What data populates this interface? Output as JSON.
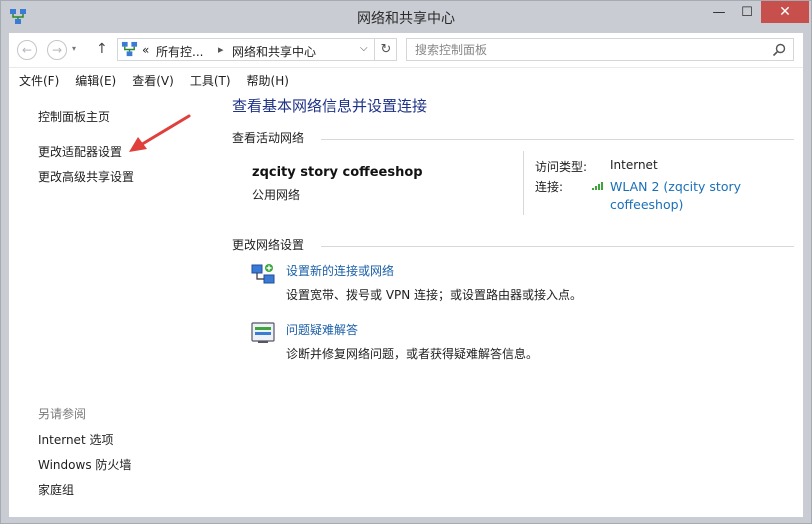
{
  "window": {
    "title": "网络和共享中心",
    "controls": {
      "minimize": "—",
      "maximize": "☐",
      "close": "✕"
    }
  },
  "nav": {
    "back_icon": "arrow-left-icon",
    "forward_icon": "arrow-right-icon",
    "up_icon": "arrow-up-icon",
    "breadcrumb": [
      "所有控...",
      "网络和共享中心"
    ],
    "overflow": "«",
    "search_placeholder": "搜索控制面板"
  },
  "menu": [
    "文件(F)",
    "编辑(E)",
    "查看(V)",
    "工具(T)",
    "帮助(H)"
  ],
  "sidebar": {
    "links": [
      "控制面板主页",
      "更改适配器设置",
      "更改高级共享设置"
    ],
    "see_also_heading": "另请参阅",
    "see_also": [
      "Internet 选项",
      "Windows 防火墙",
      "家庭组"
    ]
  },
  "main": {
    "title": "查看基本网络信息并设置连接",
    "active_networks": {
      "heading": "查看活动网络",
      "network_name": "zqcity story coffeeshop",
      "network_type": "公用网络",
      "access_type_label": "访问类型:",
      "access_type_value": "Internet",
      "connection_label": "连接:",
      "connection_value": "WLAN 2 (zqcity story coffeeshop)"
    },
    "change_settings": {
      "heading": "更改网络设置",
      "tasks": [
        {
          "link": "设置新的连接或网络",
          "desc": "设置宽带、拨号或 VPN 连接；或设置路由器或接入点。"
        },
        {
          "link": "问题疑难解答",
          "desc": "诊断并修复网络问题，或者获得疑难解答信息。"
        }
      ]
    }
  },
  "colors": {
    "link": "#1a6fb8",
    "title": "#1e3287",
    "close": "#c7504c",
    "annotation_arrow": "#e0403c"
  }
}
